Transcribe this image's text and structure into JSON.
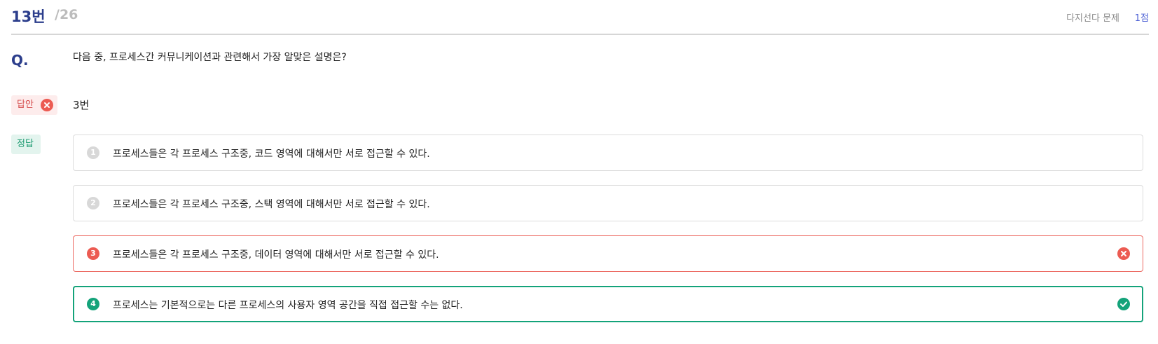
{
  "header": {
    "question_number": "13번",
    "total": "/26",
    "type": "다지선다 문제",
    "points": "1점"
  },
  "question": {
    "marker": "Q.",
    "text": "다음 중, 프로세스간 커뮤니케이션과 관련해서 가장 알맞은 설명은?"
  },
  "answer": {
    "label": "답안",
    "status_icon": "x-circle-icon",
    "value": "3번"
  },
  "correct": {
    "label": "정답"
  },
  "options": [
    {
      "number": "1",
      "text": "프로세스들은 각 프로세스 구조중, 코드 영역에 대해서만 서로 접근할 수 있다.",
      "state": "neutral"
    },
    {
      "number": "2",
      "text": "프로세스들은 각 프로세스 구조중, 스택 영역에 대해서만 서로 접근할 수 있다.",
      "state": "neutral"
    },
    {
      "number": "3",
      "text": "프로세스들은 각 프로세스 구조중, 데이터 영역에 대해서만 서로 접근할 수 있다.",
      "state": "wrong",
      "status_icon": "x-circle-icon"
    },
    {
      "number": "4",
      "text": "프로세스는 기본적으로는 다른 프로세스의 사용자 영역 공간을 직접 접근할 수는 없다.",
      "state": "correct",
      "status_icon": "check-circle-icon"
    }
  ],
  "colors": {
    "primary": "#2c3e8c",
    "wrong": "#ec5b52",
    "correct": "#14a37a",
    "neutral": "#d8d8d8"
  }
}
